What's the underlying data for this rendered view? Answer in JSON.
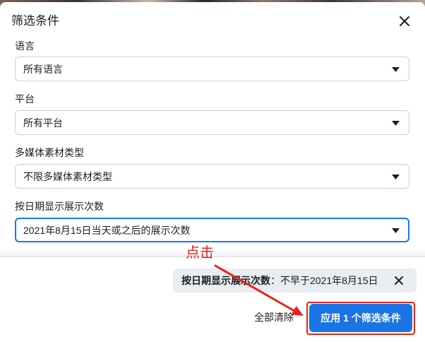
{
  "dialog": {
    "title": "筛选条件",
    "close_icon": "close-icon"
  },
  "filters": [
    {
      "label": "语言",
      "value": "所有语言",
      "icon": "caret-down-icon",
      "focused": false
    },
    {
      "label": "平台",
      "value": "所有平台",
      "icon": "caret-down-icon",
      "focused": false
    },
    {
      "label": "多媒体素材类型",
      "value": "不限多媒体素材类型",
      "icon": "caret-down-icon",
      "focused": false
    },
    {
      "label": "按日期显示展示次数",
      "value": "2021年8月15日当天或之后的展示次数",
      "icon": "caret-down-icon",
      "focused": true
    }
  ],
  "active_filter_chip": {
    "label": "按日期显示展示次数",
    "separator": "：",
    "value": "不早于2021年8月15日",
    "remove_icon": "close-icon"
  },
  "footer": {
    "clear_label": "全部清除",
    "apply_label": "应用 1 个筛选条件"
  },
  "annotation": {
    "text": "点击",
    "arrow_icon": "arrow-icon"
  },
  "colors": {
    "accent": "#1b74e4",
    "focus_border": "#1877f2",
    "annotation": "#e8231c",
    "chip_background": "#e9edf3"
  }
}
